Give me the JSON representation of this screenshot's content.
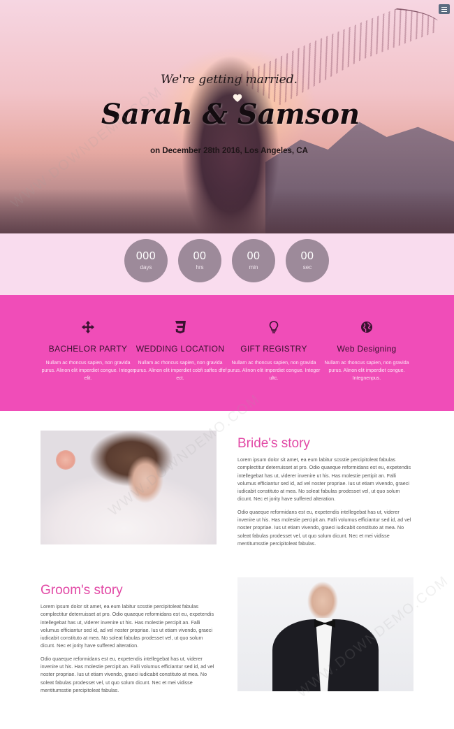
{
  "hero": {
    "tagline": "We're getting married.",
    "names": "Sarah & Samson",
    "date_location": "on December 28th 2016, Los Angeles, CA"
  },
  "nav": {
    "menu_icon": "hamburger-menu-icon"
  },
  "countdown": [
    {
      "value": "000",
      "label": "days"
    },
    {
      "value": "00",
      "label": "hrs"
    },
    {
      "value": "00",
      "label": "min"
    },
    {
      "value": "00",
      "label": "sec"
    }
  ],
  "features": [
    {
      "icon": "arrows-move-icon",
      "title": "BACHELOR PARTY",
      "text": "Nullam ac rhoncus sapien, non gravida purus. Alinon elit imperdiet congue. Integer elit."
    },
    {
      "icon": "css3-icon",
      "title": "WEDDING LOCATION",
      "text": "Nullam ac rhoncus sapien, non gravida purus. Alinon elit imperdiet cobfi saffes dfef ect."
    },
    {
      "icon": "lightbulb-icon",
      "title": "GIFT REGISTRY",
      "text": "Nullam ac rhoncus sapien, non gravida purus. Alinon elit imperdiet congue. Integer ultc."
    },
    {
      "icon": "globe-icon",
      "title": "Web Designing",
      "text": "Nullam ac rhoncus sapien, non gravida purus. Alinon elit imperdiet congue. Integnenpus."
    }
  ],
  "bride": {
    "title": "Bride's story",
    "p1": "Lorem ipsum dolor sit amet, ea eum labitur scsstie percipitoleat fabulas complectitur deterruisset at pro. Odio quaeque reformidans est eu, expetendis intellegebat has ut, viderer invenire ut his. Has molestie pertipit an. Falli volumus efficiantur sed id, ad vel noster propriae. Ius ut etiam vivendo, graeci iudicabit constituto at mea. No soleat fabulas prodesset vel, ut quo solum dicunt. Nec et jority have suffered alteration.",
    "p2": "Odio quaeque reformidans est eu, expetendis intellegebat has ut, viderer invenire ut his. Has molestie percipit an. Falli volumus efficiantur sed id, ad vel noster propriae. Ius ut etiam vivendo, graeci iudicabit constituto at mea. No soleat fabulas prodesset vel, ut quo solum dicunt. Nec et mei vidisse mentitumsstie percipitoleat fabulas."
  },
  "groom": {
    "title": "Groom's story",
    "p1": "Lorem ipsum dolor sit amet, ea eum labitur scsstie percipitoleat fabulas complectitur deterruisset at pro. Odio quaeque reformidans est eu, expetendis intellegebat has ut, viderer invenire ut his. Has molestie percipit an. Falli volumus efficiantur sed id, ad vel noster propriae. Ius ut etiam vivendo, graeci iudicabit constituto at mea. No soleat fabulas prodesset vel, ut quo solum dicunt. Nec et jority have suffered alteration.",
    "p2": "Odio quaeque reformidans est eu, expetendis intellegebat has ut, viderer invenire ut his. Has molestie percipit an. Falli volumus efficiantur sed id, ad vel noster propriae. Ius ut etiam vivendo, graeci iudicabit constituto at mea. No soleat fabulas prodesset vel, ut quo solum dicunt. Nec et mei vidisse mentitumsstie percipitoleat fabulas."
  },
  "watermark": "WWW.DOWNDEMO.COM",
  "colors": {
    "accent_pink": "#f04db8",
    "countdown_bg": "#f9dcee",
    "countdown_circle": "#9d8a9a",
    "story_title": "#e24aa6",
    "menu_button": "#5a6b80"
  }
}
